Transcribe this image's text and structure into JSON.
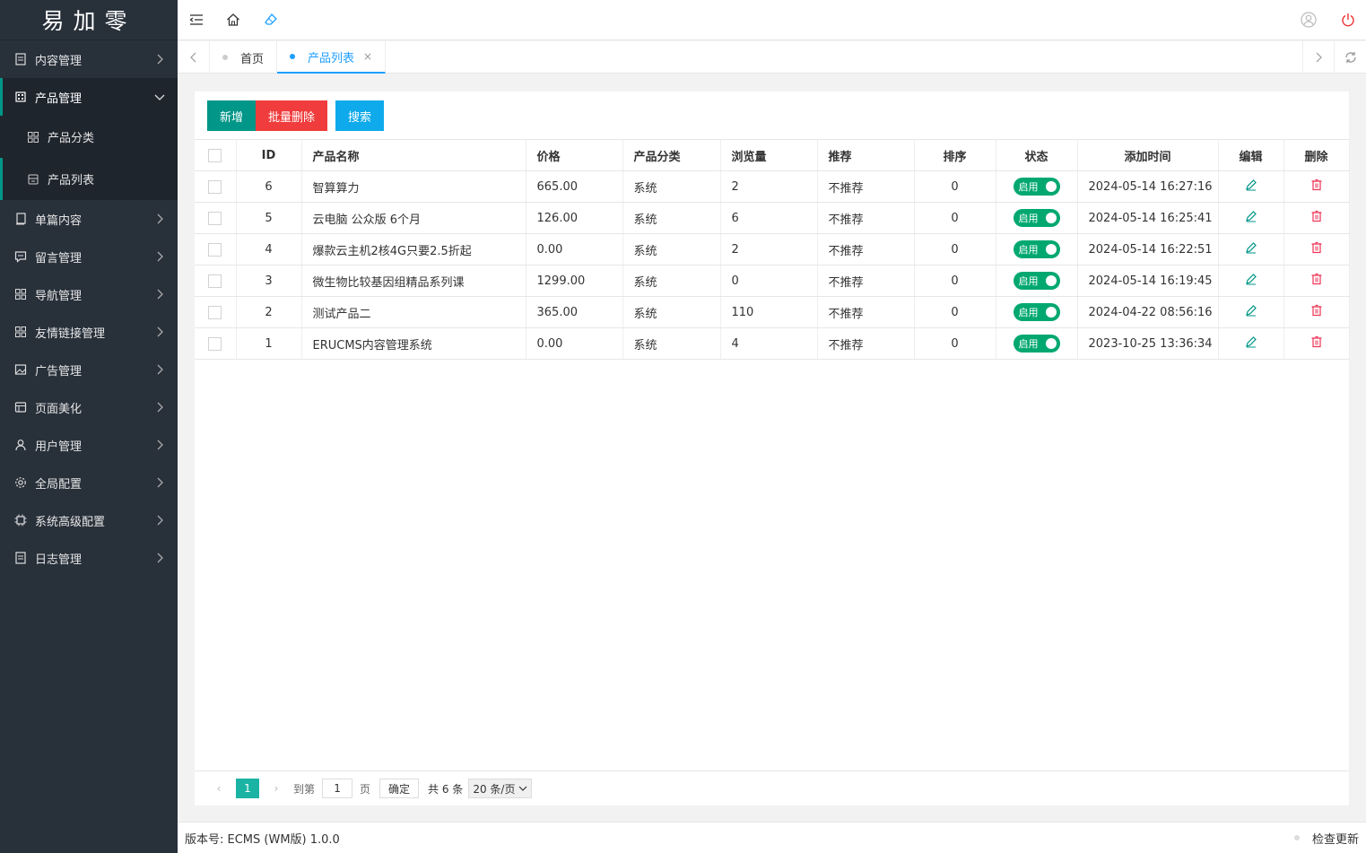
{
  "app": {
    "logo_text": "易加零"
  },
  "sidebar": {
    "items": [
      {
        "label": "内容管理",
        "icon": "document-icon",
        "expanded": false
      },
      {
        "label": "产品管理",
        "icon": "building-icon",
        "expanded": true,
        "children": [
          {
            "label": "产品分类",
            "icon": "grid-icon"
          },
          {
            "label": "产品列表",
            "icon": "box-icon",
            "current": true
          }
        ]
      },
      {
        "label": "单篇内容",
        "icon": "page-icon"
      },
      {
        "label": "留言管理",
        "icon": "message-icon"
      },
      {
        "label": "导航管理",
        "icon": "grid-icon"
      },
      {
        "label": "友情链接管理",
        "icon": "grid-icon"
      },
      {
        "label": "广告管理",
        "icon": "image-icon"
      },
      {
        "label": "页面美化",
        "icon": "template-icon"
      },
      {
        "label": "用户管理",
        "icon": "user-icon"
      },
      {
        "label": "全局配置",
        "icon": "gear-icon"
      },
      {
        "label": "系统高级配置",
        "icon": "chip-icon"
      },
      {
        "label": "日志管理",
        "icon": "document-icon"
      }
    ]
  },
  "tabs": {
    "items": [
      {
        "label": "首页"
      },
      {
        "label": "产品列表",
        "active": true
      }
    ],
    "close_glyph": "×"
  },
  "toolbar": {
    "add_label": "新增",
    "batch_delete_label": "批量删除",
    "search_label": "搜索"
  },
  "table": {
    "headers": {
      "id": "ID",
      "name": "产品名称",
      "price": "价格",
      "category": "产品分类",
      "views": "浏览量",
      "recommend": "推荐",
      "sort": "排序",
      "status": "状态",
      "time": "添加时间",
      "edit": "编辑",
      "delete": "删除"
    },
    "rows": [
      {
        "id": "6",
        "name": "智算算力",
        "price": "665.00",
        "category": "系统",
        "views": "2",
        "recommend": "不推荐",
        "sort": "0",
        "status": "启用",
        "time": "2024-05-14 16:27:16"
      },
      {
        "id": "5",
        "name": "云电脑 公众版 6个月",
        "price": "126.00",
        "category": "系统",
        "views": "6",
        "recommend": "不推荐",
        "sort": "0",
        "status": "启用",
        "time": "2024-05-14 16:25:41"
      },
      {
        "id": "4",
        "name": "爆款云主机2核4G只要2.5折起",
        "price": "0.00",
        "category": "系统",
        "views": "2",
        "recommend": "不推荐",
        "sort": "0",
        "status": "启用",
        "time": "2024-05-14 16:22:51"
      },
      {
        "id": "3",
        "name": "微生物比较基因组精品系列课",
        "price": "1299.00",
        "category": "系统",
        "views": "0",
        "recommend": "不推荐",
        "sort": "0",
        "status": "启用",
        "time": "2024-05-14 16:19:45"
      },
      {
        "id": "2",
        "name": "测试产品二",
        "price": "365.00",
        "category": "系统",
        "views": "110",
        "recommend": "不推荐",
        "sort": "0",
        "status": "启用",
        "time": "2024-04-22 08:56:16"
      },
      {
        "id": "1",
        "name": "ERUCMS内容管理系统",
        "price": "0.00",
        "category": "系统",
        "views": "4",
        "recommend": "不推荐",
        "sort": "0",
        "status": "启用",
        "time": "2023-10-25 13:36:34"
      }
    ]
  },
  "pager": {
    "current_page": "1",
    "goto_label": "到第",
    "page_input_value": "1",
    "page_unit": "页",
    "confirm_label": "确定",
    "total_label": "共 6 条",
    "page_size_label": "20 条/页"
  },
  "footer": {
    "version_label": "版本号: ECMS (WM版) 1.0.0",
    "check_update_label": "检查更新"
  },
  "colors": {
    "sidebar_bg": "#28303a",
    "accent_green": "#009688",
    "danger_red": "#f03c3c",
    "info_blue": "#0eaaeb",
    "tab_active": "#1e9fff"
  }
}
